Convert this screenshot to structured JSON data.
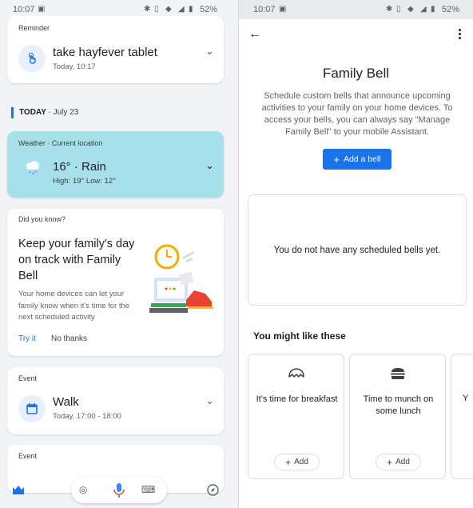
{
  "left": {
    "status": {
      "time": "10:07",
      "battery": "52%"
    },
    "reminder": {
      "label": "Reminder",
      "title": "take hayfever tablet",
      "time": "Today, 10:17"
    },
    "today": {
      "label": "TODAY",
      "date": "· July 23"
    },
    "weather": {
      "label": "Weather · Current location",
      "temp": "16° · Rain",
      "hilo": "High: 19° Low: 12°"
    },
    "did_you_know": {
      "label": "Did you know?",
      "title": "Keep your family's day on track with Family Bell",
      "body": "Your home devices can let your family know when it's time for the next scheduled activity",
      "try_label": "Try it",
      "no_label": "No thanks"
    },
    "event": {
      "label": "Event",
      "title": "Walk",
      "time": "Today, 17:00 - 18:00"
    },
    "event2": {
      "label": "Event"
    },
    "icons": [
      "inbox-icon",
      "lens-icon",
      "mic-icon",
      "keyboard-icon",
      "compass-icon"
    ]
  },
  "right": {
    "status": {
      "time": "10:07",
      "battery": "52%"
    },
    "title": "Family Bell",
    "description": "Schedule custom bells that announce upcoming activities to your family on your home devices. To access your bells, you can always say \"Manage Family Bell\" to your mobile Assistant.",
    "add_bell_label": "Add a bell",
    "empty_text": "You do not have any scheduled bells yet.",
    "suggest_heading": "You might like these",
    "suggestions": [
      {
        "icon": "croissant-icon",
        "text": "It's time for breakfast",
        "add_label": "Add"
      },
      {
        "icon": "burger-icon",
        "text": "Time to munch on some lunch",
        "add_label": "Add"
      }
    ],
    "partial_suggestion_text": "Y",
    "accent_color": "#1a73e8",
    "weather_card_color": "#a7dfea"
  }
}
